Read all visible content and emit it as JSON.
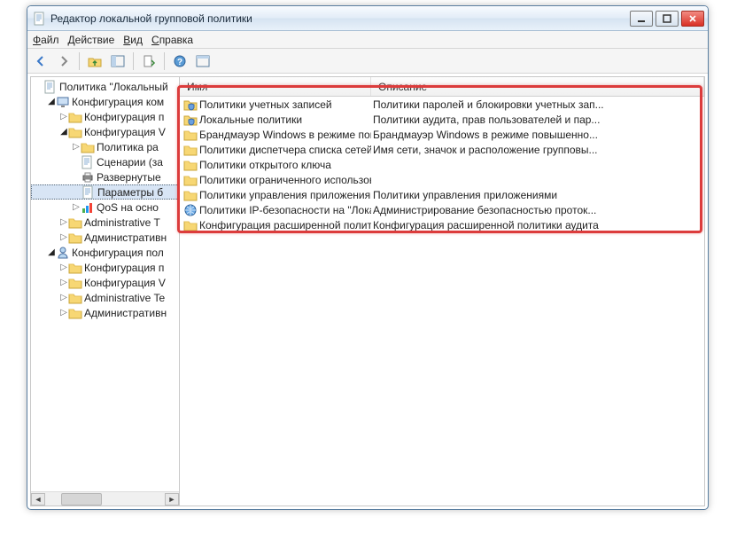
{
  "window": {
    "title": "Редактор локальной групповой политики"
  },
  "menu": {
    "file": "Файл",
    "action": "Действие",
    "view": "Вид",
    "help": "Справка"
  },
  "tree": {
    "root": "Политика \"Локальный",
    "cc": "Конфигурация ком",
    "cc_cp": "Конфигурация п",
    "cc_cw": "Конфигурация V",
    "cc_cw_pr": "Политика ра",
    "cc_cw_sc": "Сценарии (за",
    "cc_cw_rz": "Развернутые",
    "cc_cw_pb": "Параметры б",
    "cc_cw_qos": "QoS на осно",
    "cc_at": "Administrative T",
    "cc_av": "Административн",
    "cu": "Конфигурация пол",
    "cu_cp": "Конфигурация п",
    "cu_cw": "Конфигурация V",
    "cu_at": "Administrative Te",
    "cu_av": "Административн"
  },
  "list": {
    "col1": "Имя",
    "col2": "Описание",
    "rows": [
      {
        "name": "Политики учетных записей",
        "desc": "Политики паролей и блокировки учетных зап...",
        "icon": "folder-shield"
      },
      {
        "name": "Локальные политики",
        "desc": "Политики аудита, прав пользователей и пар...",
        "icon": "folder-shield"
      },
      {
        "name": "Брандмауэр Windows в режиме повы...",
        "desc": "Брандмауэр Windows в режиме повышенно...",
        "icon": "folder"
      },
      {
        "name": "Политики диспетчера списка сетей",
        "desc": "Имя сети, значок и расположение групповы...",
        "icon": "folder"
      },
      {
        "name": "Политики открытого ключа",
        "desc": "",
        "icon": "folder"
      },
      {
        "name": "Политики ограниченного использован...",
        "desc": "",
        "icon": "folder"
      },
      {
        "name": "Политики управления приложениями",
        "desc": "Политики управления приложениями",
        "icon": "folder"
      },
      {
        "name": "Политики IP-безопасности на \"Локаль...",
        "desc": "Администрирование безопасностью проток...",
        "icon": "globe"
      },
      {
        "name": "Конфигурация расширенной политик...",
        "desc": "Конфигурация расширенной политики аудита",
        "icon": "folder"
      }
    ]
  }
}
